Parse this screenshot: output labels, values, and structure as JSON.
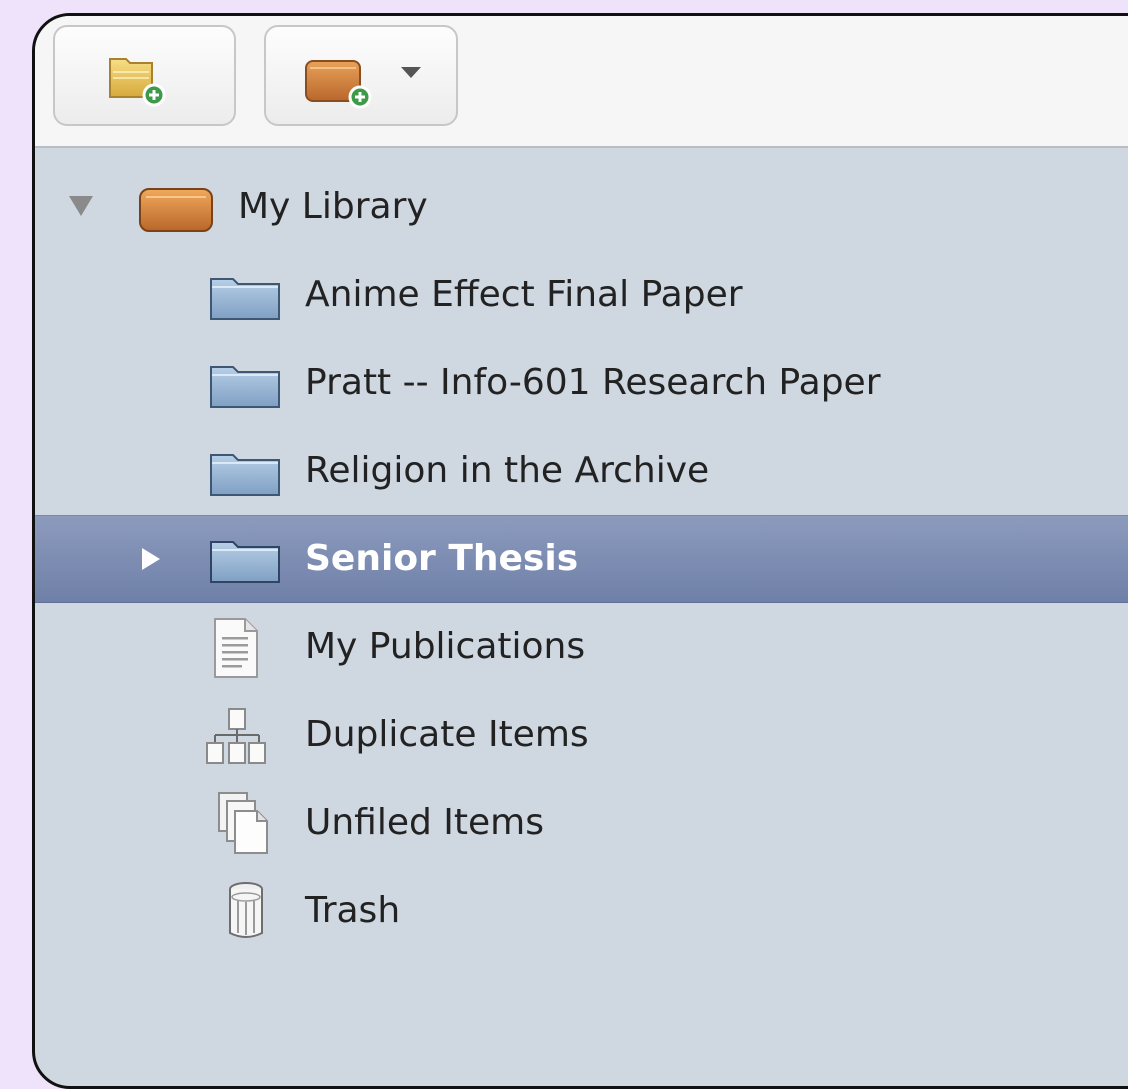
{
  "toolbar": {
    "new_collection_icon": "folder-add-icon",
    "new_library_icon": "library-add-icon",
    "dropdown_icon": "caret-down-icon"
  },
  "tree": {
    "root": {
      "label": "My Library",
      "icon": "library-icon",
      "expanded": true
    },
    "items": [
      {
        "label": "Anime Effect Final Paper",
        "icon": "folder-icon"
      },
      {
        "label": "Pratt -- Info-601 Research Paper",
        "icon": "folder-icon"
      },
      {
        "label": "Religion in the Archive",
        "icon": "folder-icon"
      },
      {
        "label": "Senior Thesis",
        "icon": "folder-icon",
        "selected": true,
        "expandable": true
      },
      {
        "label": "My Publications",
        "icon": "document-icon"
      },
      {
        "label": "Duplicate Items",
        "icon": "duplicate-items-icon"
      },
      {
        "label": "Unfiled Items",
        "icon": "unfiled-items-icon"
      },
      {
        "label": "Trash",
        "icon": "trash-icon"
      }
    ]
  },
  "colors": {
    "background": "#efe2fb",
    "pane": "#cfd7e1",
    "selection": "#7b8bb1",
    "toolbar": "#f6f6f6"
  }
}
